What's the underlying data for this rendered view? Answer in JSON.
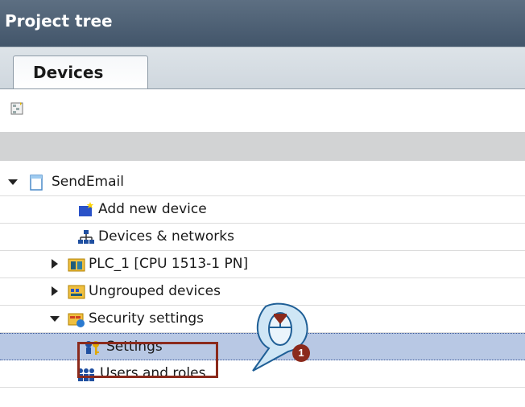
{
  "header": {
    "title": "Project tree"
  },
  "tabs": {
    "active": "Devices"
  },
  "toolbar": {
    "icon": "tree-view-icon"
  },
  "tree": {
    "root": {
      "label": "SendEmail",
      "icon": "project-icon"
    },
    "items": [
      {
        "label": "Add new device",
        "icon": "add-device-icon"
      },
      {
        "label": "Devices & networks",
        "icon": "network-icon"
      },
      {
        "label": "PLC_1 [CPU 1513-1 PN]",
        "icon": "plc-icon"
      },
      {
        "label": "Ungrouped devices",
        "icon": "ungrouped-devices-icon"
      },
      {
        "label": "Security settings",
        "icon": "security-settings-icon"
      },
      {
        "label": "Settings",
        "icon": "key-icon"
      },
      {
        "label": "Users and roles",
        "icon": "users-icon"
      }
    ]
  },
  "annotation": {
    "step": "1",
    "color": "#8b2a1c"
  }
}
